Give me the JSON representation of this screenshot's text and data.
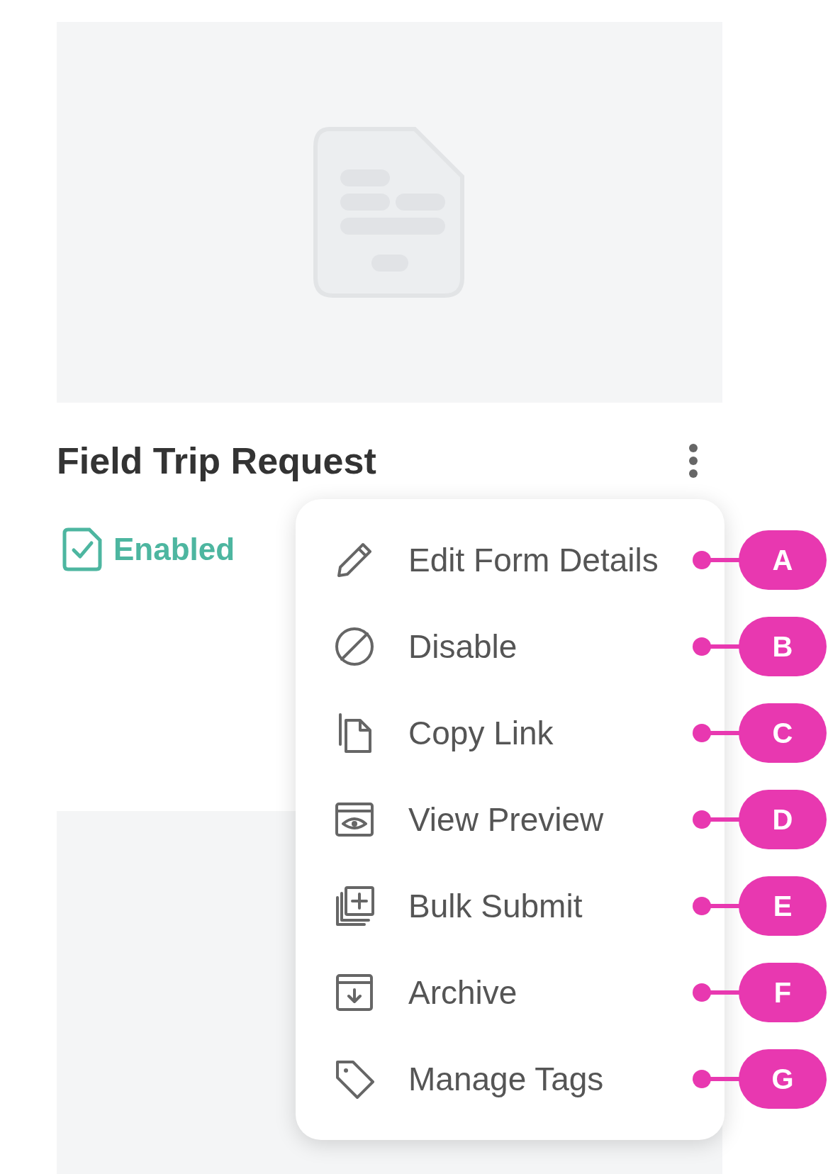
{
  "form_card": {
    "title": "Field Trip Request",
    "status": "Enabled"
  },
  "menu": {
    "items": [
      {
        "label": "Edit Form Details"
      },
      {
        "label": "Disable"
      },
      {
        "label": "Copy Link"
      },
      {
        "label": "View Preview"
      },
      {
        "label": "Bulk Submit"
      },
      {
        "label": "Archive"
      },
      {
        "label": "Manage Tags"
      }
    ]
  },
  "callouts": [
    "A",
    "B",
    "C",
    "D",
    "E",
    "F",
    "G"
  ]
}
